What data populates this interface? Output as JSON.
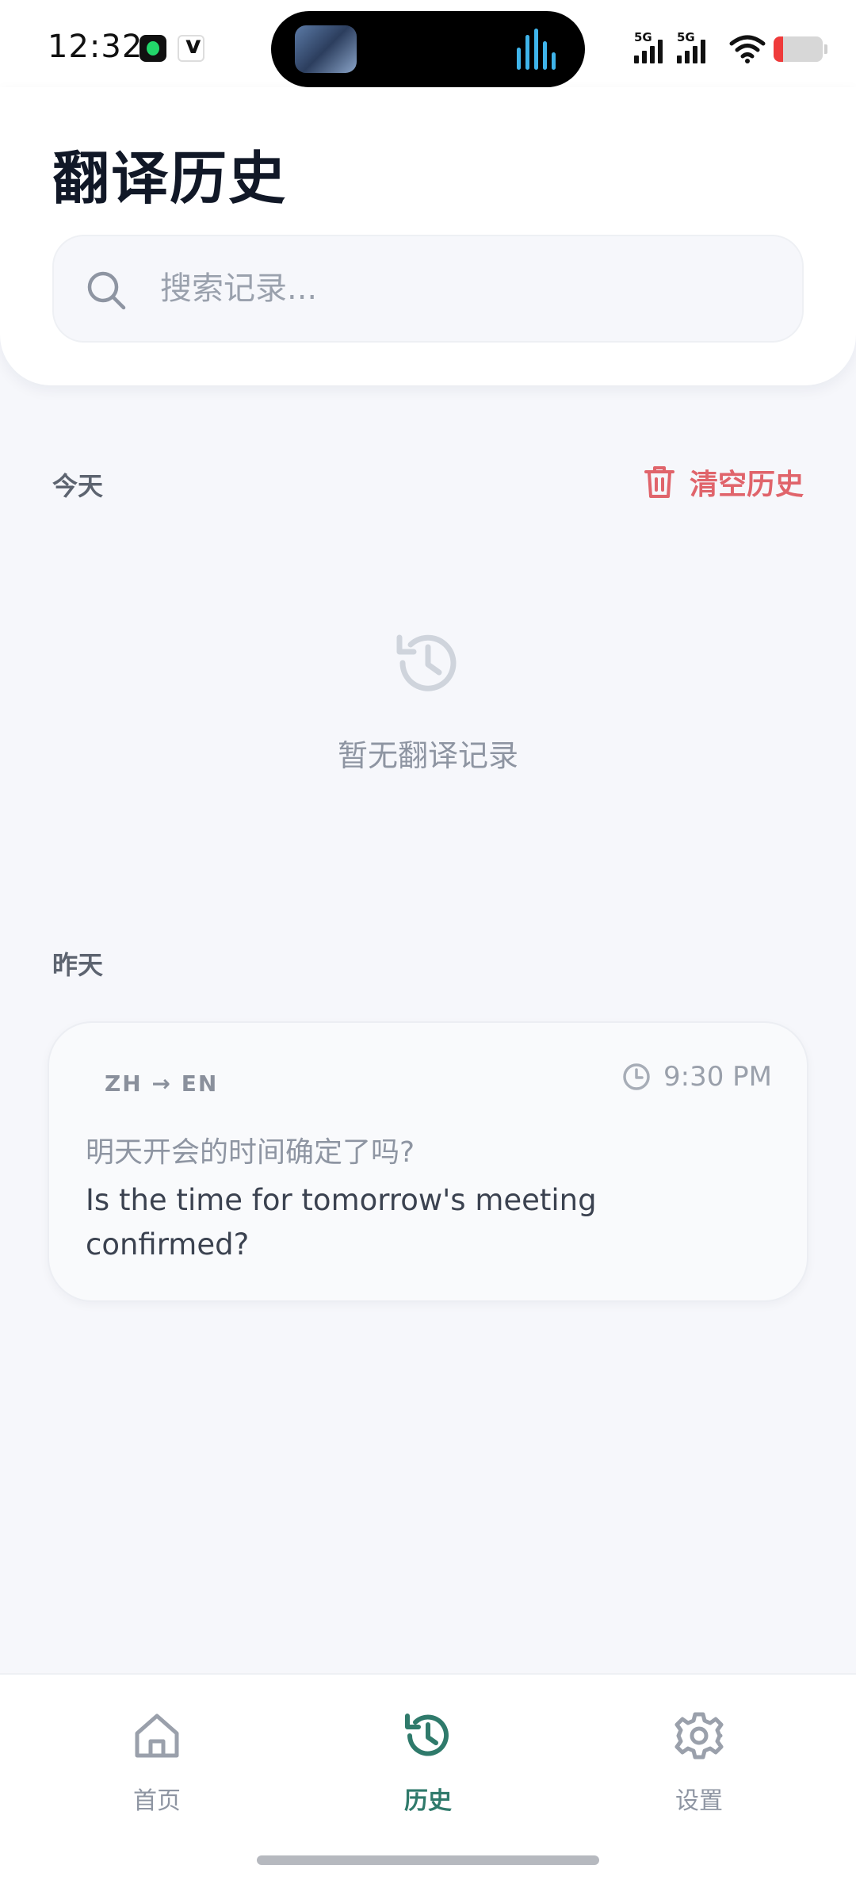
{
  "status_bar": {
    "time": "12:32",
    "signal1_label": "5G",
    "signal2_label": "5G"
  },
  "header": {
    "title": "翻译历史"
  },
  "search": {
    "placeholder": "搜索记录..."
  },
  "sections": {
    "today_label": "今天",
    "clear_history_label": "清空历史",
    "empty_message": "暂无翻译记录",
    "yesterday_label": "昨天"
  },
  "history_items": [
    {
      "lang_pair": "ZH → EN",
      "time": "9:30 PM",
      "source": "明天开会的时间确定了吗?",
      "target": "Is the time for tomorrow's meeting confirmed?"
    }
  ],
  "nav": {
    "items": [
      {
        "label": "首页",
        "icon": "home-icon"
      },
      {
        "label": "历史",
        "icon": "history-icon"
      },
      {
        "label": "设置",
        "icon": "gear-icon"
      }
    ],
    "active_index": 1
  },
  "colors": {
    "accent": "#2f7a6b",
    "danger": "#e0646b",
    "background": "#f6f7fb"
  }
}
